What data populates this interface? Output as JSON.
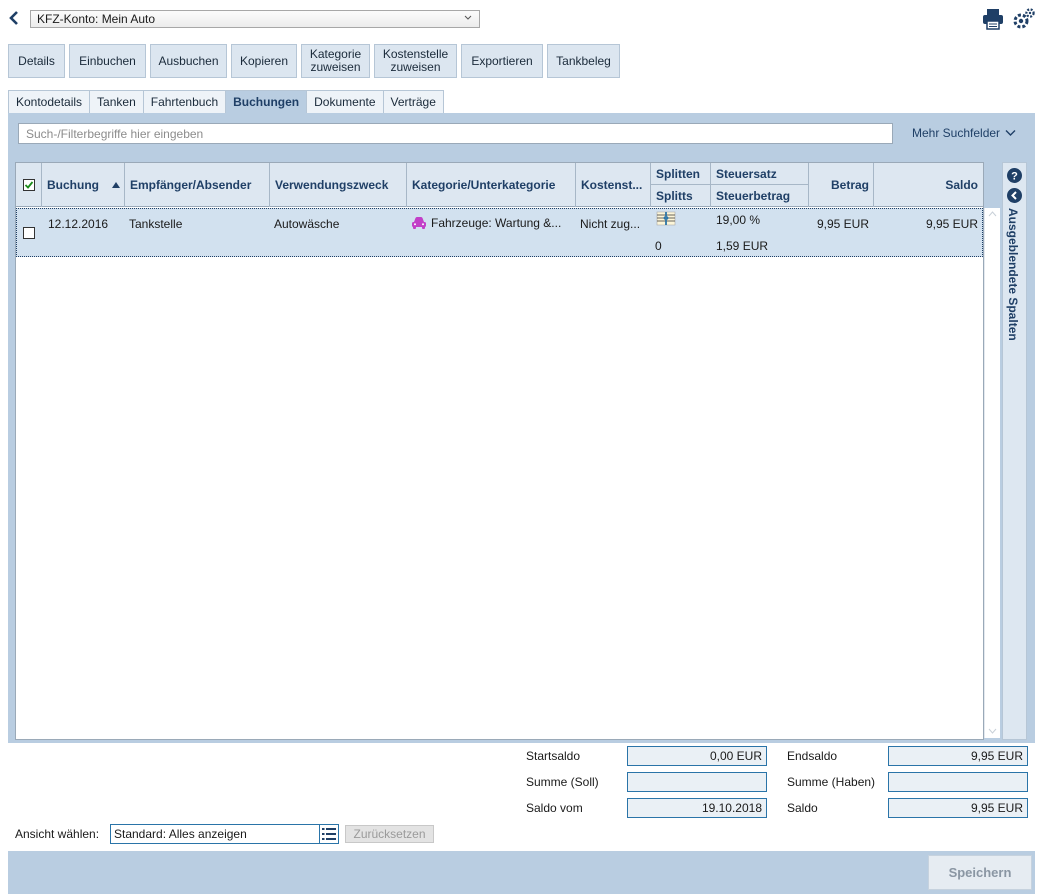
{
  "header": {
    "account_select": "KFZ-Konto: Mein Auto"
  },
  "toolbar": {
    "details": "Details",
    "einbuchen": "Einbuchen",
    "ausbuchen": "Ausbuchen",
    "kopieren": "Kopieren",
    "kategorie_l1": "Kategorie",
    "kategorie_l2": "zuweisen",
    "kostenstelle_l1": "Kostenstelle",
    "kostenstelle_l2": "zuweisen",
    "exportieren": "Exportieren",
    "tankbeleg": "Tankbeleg"
  },
  "tabs": [
    "Kontodetails",
    "Tanken",
    "Fahrtenbuch",
    "Buchungen",
    "Dokumente",
    "Verträge"
  ],
  "active_tab": "Buchungen",
  "search": {
    "placeholder": "Such-/Filterbegriffe hier eingeben",
    "more_fields": "Mehr Suchfelder"
  },
  "table": {
    "headers": {
      "buchung": "Buchung",
      "empfaenger": "Empfänger/Absender",
      "verwendungszweck": "Verwendungszweck",
      "kategorie": "Kategorie/Unterkategorie",
      "kostenstelle": "Kostenst...",
      "splitten": "Splitten",
      "splitts": "Splitts",
      "steuersatz": "Steuersatz",
      "steuerbetrag": "Steuerbetrag",
      "betrag": "Betrag",
      "saldo": "Saldo"
    },
    "rows": [
      {
        "date": "12.12.2016",
        "empfaenger": "Tankstelle",
        "verwendungszweck": "Autowäsche",
        "kategorie": "Fahrzeuge: Wartung &...",
        "kostenstelle": "Nicht zug...",
        "splitts": "0",
        "steuersatz": "19,00 %",
        "steuerbetrag": "1,59 EUR",
        "betrag": "9,95 EUR",
        "saldo": "9,95 EUR"
      }
    ]
  },
  "sidebar": {
    "hidden_columns": "Ausgeblendete Spalten"
  },
  "summary": {
    "startsaldo_label": "Startsaldo",
    "startsaldo": "0,00 EUR",
    "summe_soll_label": "Summe (Soll)",
    "summe_soll": "",
    "saldo_vom_label": "Saldo vom",
    "saldo_vom": "19.10.2018",
    "endsaldo_label": "Endsaldo",
    "endsaldo": "9,95 EUR",
    "summe_haben_label": "Summe (Haben)",
    "summe_haben": "",
    "saldo_label": "Saldo",
    "saldo": "9,95 EUR"
  },
  "view": {
    "label": "Ansicht wählen:",
    "value": "Standard: Alles anzeigen",
    "reset": "Zurücksetzen"
  },
  "footer": {
    "save": "Speichern"
  },
  "colors": {
    "panel": "#b9cde1",
    "header_text": "#1f3f66",
    "selected_row": "#d2e1ef",
    "category_icon": "#c23fc8"
  }
}
